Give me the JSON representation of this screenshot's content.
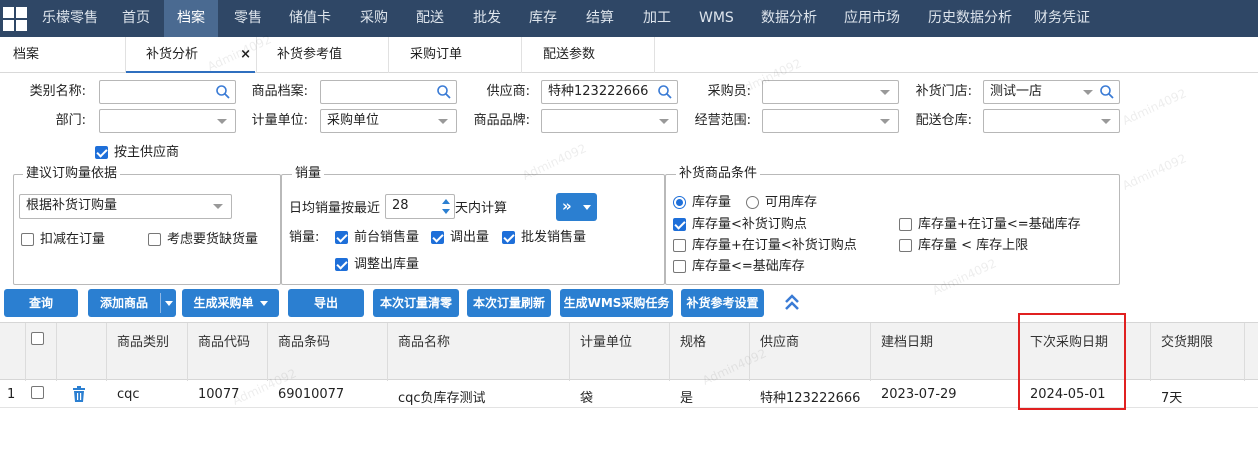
{
  "nav": {
    "brand": "乐檬零售",
    "items": [
      "首页",
      "档案",
      "零售",
      "储值卡",
      "采购",
      "配送",
      "批发",
      "库存",
      "结算",
      "加工",
      "WMS",
      "数据分析",
      "应用市场",
      "历史数据分析",
      "财务凭证"
    ],
    "active": "档案"
  },
  "tabs": [
    {
      "label": "档案"
    },
    {
      "label": "补货分析",
      "close": "×"
    },
    {
      "label": "补货参考值"
    },
    {
      "label": "采购订单"
    },
    {
      "label": "配送参数"
    }
  ],
  "filters": {
    "category_label": "类别名称:",
    "item_label": "商品档案:",
    "supplier_label": "供应商:",
    "supplier_value": "特种123222666",
    "buyer_label": "采购员:",
    "store_label": "补货门店:",
    "store_value": "测试一店",
    "dept_label": "部门:",
    "unit_label": "计量单位:",
    "unit_value": "采购单位",
    "brand_label": "商品品牌:",
    "scope_label": "经营范围:",
    "warehouse_label": "配送仓库:",
    "main_supplier": "按主供应商"
  },
  "groups": {
    "suggest": {
      "title": "建议订购量依据",
      "select": "根据补货订购量",
      "opt1": "扣减在订量",
      "opt2": "考虑要货缺货量"
    },
    "sales": {
      "title": "销量",
      "days_prefix": "日均销量按最近",
      "days_value": "28",
      "days_suffix": "天内计算",
      "more": "»",
      "sales_label": "销量:",
      "c1": "前台销售量",
      "c2": "调出量",
      "c3": "批发销售量",
      "c4": "调整出库量"
    },
    "cond": {
      "title": "补货商品条件",
      "r1": "库存量",
      "r2": "可用库存",
      "c1": "库存量<补货订购点",
      "c2": "库存量+在订量<=基础库存",
      "c3": "库存量+在订量<补货订购点",
      "c4": "库存量 < 库存上限",
      "c5": "库存量<=基础库存"
    }
  },
  "actions": {
    "query": "查询",
    "add": "添加商品",
    "gen_po": "生成采购单",
    "export": "导出",
    "clear": "本次订量清零",
    "refresh": "本次订量刷新",
    "wms": "生成WMS采购任务",
    "settings": "补货参考设置"
  },
  "table": {
    "headers": [
      "商品类别",
      "商品代码",
      "商品条码",
      "商品名称",
      "计量单位",
      "规格",
      "供应商",
      "建档日期",
      "下次采购日期",
      "交货期限"
    ],
    "rows": [
      {
        "no": "1",
        "category": "cqc",
        "code": "10077",
        "barcode": "69010077",
        "name": "cqc负库存测试",
        "unit": "袋",
        "spec": "是",
        "supplier": "特种123222666",
        "created": "2023-07-29",
        "next_date": "2024-05-01",
        "lead": "7天"
      }
    ]
  },
  "watermark": "Admin4092",
  "colors": {
    "nav_bg": "#2f4766",
    "nav_active": "#4a6a91",
    "button": "#2b7fd1",
    "highlight_box": "#e02020",
    "checkbox": "#1e6fd9"
  }
}
